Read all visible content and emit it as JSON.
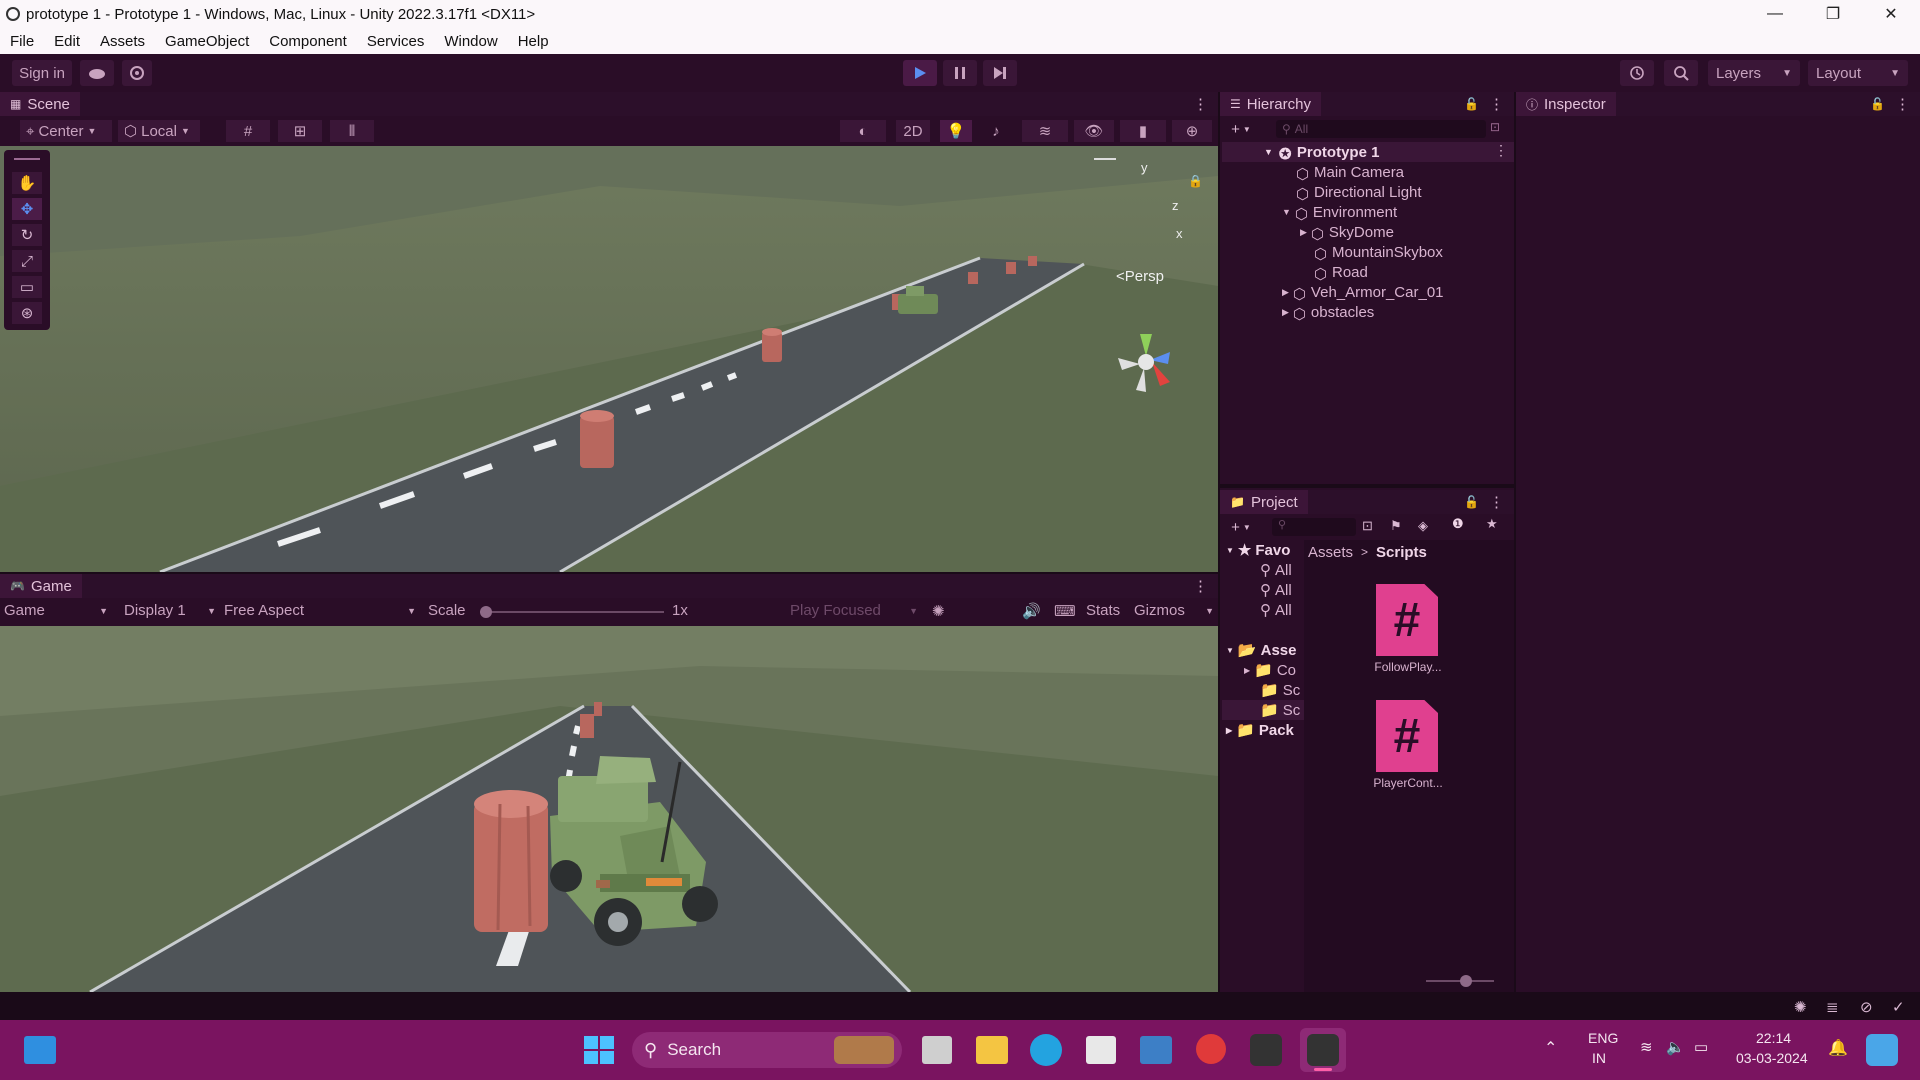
{
  "window": {
    "title": "prototype 1 - Prototype 1 - Windows, Mac, Linux - Unity 2022.3.17f1 <DX11>",
    "controls": [
      "—",
      "❐",
      "✕"
    ]
  },
  "menu": [
    "File",
    "Edit",
    "Assets",
    "GameObject",
    "Component",
    "Services",
    "Window",
    "Help"
  ],
  "toolbar": {
    "sign_in": "Sign in",
    "layers": "Layers",
    "layout": "Layout"
  },
  "scene": {
    "tab": "Scene",
    "pivot": "Center",
    "space": "Local",
    "mode_2d": "2D",
    "persp": "<Persp",
    "gizmo_y": "y",
    "gizmo_z": "z",
    "gizmo_x": "x"
  },
  "game": {
    "tab": "Game",
    "view": "Game",
    "display": "Display 1",
    "aspect": "Free Aspect",
    "scale_label": "Scale",
    "scale_value": "1x",
    "play_focused": "Play Focused",
    "stats": "Stats",
    "gizmos": "Gizmos"
  },
  "hierarchy": {
    "tab": "Hierarchy",
    "search_placeholder": "All",
    "items": [
      {
        "label": "Prototype 1"
      },
      {
        "label": "Main Camera"
      },
      {
        "label": "Directional Light"
      },
      {
        "label": "Environment"
      },
      {
        "label": "SkyDome"
      },
      {
        "label": "MountainSkybox"
      },
      {
        "label": "Road"
      },
      {
        "label": "Veh_Armor_Car_01"
      },
      {
        "label": "obstacles"
      }
    ]
  },
  "inspector": {
    "tab": "Inspector"
  },
  "project": {
    "tab": "Project",
    "tree": [
      "Favo",
      "All",
      "All",
      "All",
      "Asse",
      "Co",
      "Sc",
      "Sc",
      "Pack"
    ],
    "breadcrumb": [
      "Assets",
      "Scripts"
    ],
    "assets": [
      "FollowPlay...",
      "PlayerCont..."
    ]
  },
  "taskbar": {
    "search": "Search",
    "lang_1": "ENG",
    "lang_2": "IN",
    "time": "22:14",
    "date": "03-03-2024"
  },
  "colors": {
    "panel_bg": "#2a0d27",
    "accent": "#e0408f",
    "taskbar": "#7a1460"
  }
}
